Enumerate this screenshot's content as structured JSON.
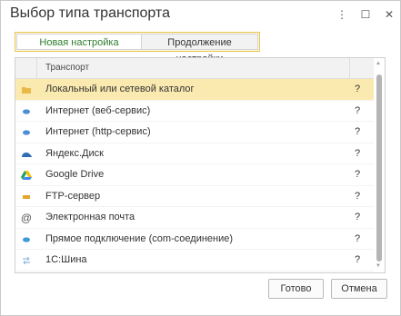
{
  "window": {
    "title": "Выбор типа транспорта",
    "controls": {
      "more": "⋮",
      "maximize": "☐",
      "close": "✕"
    }
  },
  "tabs": [
    {
      "label": "Новая настройка",
      "active": true
    },
    {
      "label": "Продолжение настройки",
      "active": false
    }
  ],
  "table": {
    "header": {
      "label": "Транспорт"
    },
    "rows": [
      {
        "label": "Локальный или сетевой каталог",
        "q": "?",
        "icon": "folder-icon",
        "selected": true
      },
      {
        "label": "Интернет (веб-сервис)",
        "q": "?",
        "icon": "web-service-icon",
        "selected": false
      },
      {
        "label": "Интернет (http-сервис)",
        "q": "?",
        "icon": "http-service-icon",
        "selected": false
      },
      {
        "label": "Яндекс.Диск",
        "q": "?",
        "icon": "yandex-disk-icon",
        "selected": false
      },
      {
        "label": "Google Drive",
        "q": "?",
        "icon": "google-drive-icon",
        "selected": false
      },
      {
        "label": "FTP-сервер",
        "q": "?",
        "icon": "ftp-icon",
        "selected": false
      },
      {
        "label": "Электронная почта",
        "q": "?",
        "icon": "email-icon",
        "selected": false
      },
      {
        "label": "Прямое подключение (com-соединение)",
        "q": "?",
        "icon": "com-connection-icon",
        "selected": false
      },
      {
        "label": "1С:Шина",
        "q": "?",
        "icon": "bus-icon",
        "selected": false
      }
    ]
  },
  "buttons": {
    "ok": "Готово",
    "cancel": "Отмена"
  },
  "colors": {
    "selected_row": "#fbeab0",
    "active_tab_text": "#2d7d2d",
    "tab_border": "#e8c44f"
  }
}
